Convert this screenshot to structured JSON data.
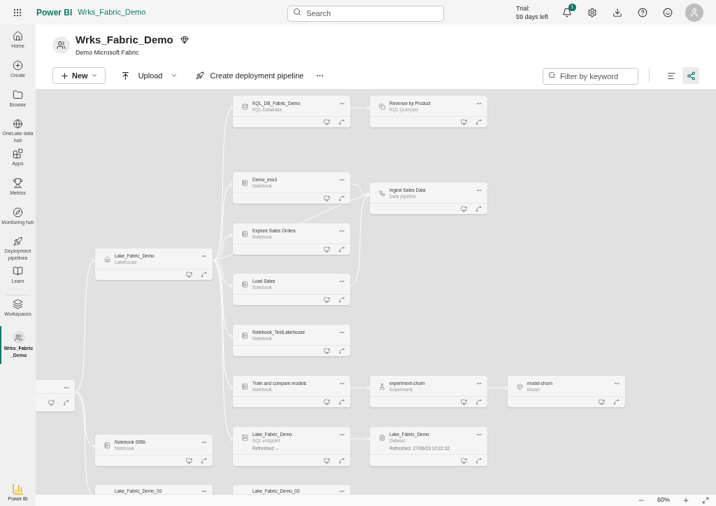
{
  "top_bar": {
    "app_name": "Power BI",
    "workspace_link": "Wrks_Fabric_Demo",
    "search": {
      "placeholder": "Search"
    },
    "trial_label": "Trial:",
    "trial_days": "59 days left",
    "notification_count": "1"
  },
  "sidebar": {
    "items": [
      {
        "label": "Home",
        "selected": false
      },
      {
        "label": "Create",
        "selected": false
      },
      {
        "label": "Browse",
        "selected": false
      },
      {
        "label": "OneLake data hub",
        "selected": false
      },
      {
        "label": "Apps",
        "selected": false
      },
      {
        "label": "Metrics",
        "selected": false
      },
      {
        "label": "Monitoring hub",
        "selected": false
      },
      {
        "label": "Deployment pipelines",
        "selected": false
      },
      {
        "label": "Learn",
        "selected": false
      },
      {
        "label": "Workspaces",
        "selected": false
      },
      {
        "label": "Wrks_Fabric _Demo",
        "selected": true
      }
    ],
    "footer_label": "Power BI"
  },
  "workspace": {
    "title": "Wrks_Fabric_Demo",
    "subtitle": "Demo Microsoft Fabric"
  },
  "toolbar": {
    "new_button": "New",
    "upload_button": "Upload",
    "pipeline_button": "Create deployment pipeline",
    "more": "···",
    "filter": {
      "placeholder": "Filter by keyword"
    },
    "views": [
      {
        "kind": "list",
        "selected": false
      },
      {
        "kind": "lineage",
        "selected": true
      }
    ]
  },
  "lineage": {
    "nodes": [
      {
        "kind": "clipped"
      },
      {
        "kind": "lakehouse",
        "title": "Lake_Fabric_Demo",
        "subtitle": "Lakehouse"
      },
      {
        "kind": "kql_database",
        "title": "KQL_DB_Fabric_Demo",
        "subtitle": "KQL Database"
      },
      {
        "kind": "notebook",
        "title": "Demo_exo3",
        "subtitle": "Notebook"
      },
      {
        "kind": "notebook",
        "title": "Explore Sales Orders",
        "subtitle": "Notebook"
      },
      {
        "kind": "notebook",
        "title": "Load Sales",
        "subtitle": "Notebook"
      },
      {
        "kind": "notebook",
        "title": "Notebook_TestLakehouse",
        "subtitle": "Notebook"
      },
      {
        "kind": "notebook",
        "title": "Train and compare models",
        "subtitle": "Notebook"
      },
      {
        "kind": "sql_endpoint",
        "title": "Lake_Fabric_Demo",
        "subtitle": "SQL endpoint",
        "refreshed": "Refreshed: --"
      },
      {
        "kind": "clipped_title",
        "title": "Lake_Fabric_Demo_02"
      },
      {
        "kind": "notebook",
        "title": "Notebook 095b",
        "subtitle": "Notebook"
      },
      {
        "kind": "clipped_title",
        "title": "Lake_Fabric_Demo_02"
      },
      {
        "kind": "kql_queryset",
        "title": "Revenue by Product",
        "subtitle": "KQL Queryset"
      },
      {
        "kind": "pipeline",
        "title": "Ingest Sales Data",
        "subtitle": "Data pipeline"
      },
      {
        "kind": "experiment",
        "title": "experiment-churn",
        "subtitle": "Experiment"
      },
      {
        "kind": "dataset",
        "title": "Lake_Fabric_Demo",
        "subtitle": "Dataset",
        "refreshed": "Refreshed: 27/06/23 10:22:32"
      },
      {
        "kind": "model",
        "title": "model-churn",
        "subtitle": "Model"
      }
    ]
  },
  "zoom": {
    "value": "60%"
  }
}
